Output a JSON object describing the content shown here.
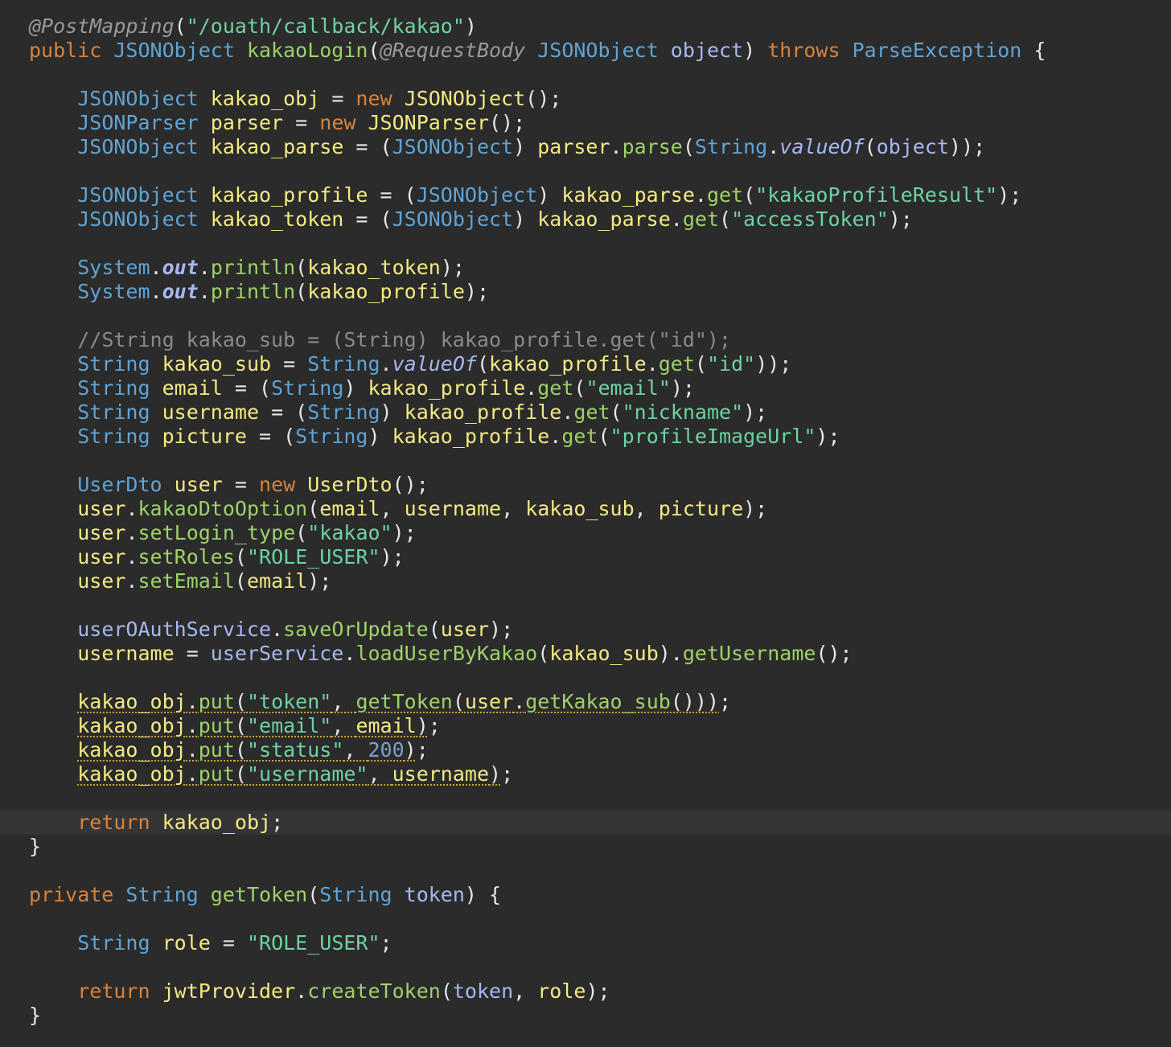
{
  "editor": {
    "theme": "dark",
    "background": "#2b2b2b",
    "current_line_index": 33,
    "colors": {
      "keyword": "#d9823b",
      "type": "#5fa4d6",
      "function": "#9ed267",
      "variable": "#f3ea83",
      "parameter": "#a7b8f3",
      "string": "#6fd2a3",
      "number": "#7d9fd0",
      "annotation": "#9a9a9a",
      "comment": "#8a8a8a",
      "warning_underline": "#c9a33b"
    },
    "lines": [
      [
        [
          "@PostMapping",
          "ann"
        ],
        [
          "(",
          "punc"
        ],
        [
          "\"/ouath/callback/kakao\"",
          "str"
        ],
        [
          ")",
          "punc"
        ]
      ],
      [
        [
          "public",
          "kw"
        ],
        [
          " ",
          "def"
        ],
        [
          "JSONObject",
          "type"
        ],
        [
          " ",
          "def"
        ],
        [
          "kakaoLogin",
          "fn"
        ],
        [
          "(",
          "punc"
        ],
        [
          "@RequestBody",
          "ann"
        ],
        [
          " ",
          "def"
        ],
        [
          "JSONObject",
          "type"
        ],
        [
          " ",
          "def"
        ],
        [
          "object",
          "param"
        ],
        [
          ") ",
          "punc"
        ],
        [
          "throws",
          "kw"
        ],
        [
          " ",
          "def"
        ],
        [
          "ParseException",
          "type"
        ],
        [
          " {",
          "punc"
        ]
      ],
      [],
      [
        [
          "    ",
          "def"
        ],
        [
          "JSONObject",
          "type"
        ],
        [
          " ",
          "def"
        ],
        [
          "kakao_obj",
          "var"
        ],
        [
          " = ",
          "punc"
        ],
        [
          "new",
          "kw"
        ],
        [
          " ",
          "def"
        ],
        [
          "JSONObject",
          "var"
        ],
        [
          "();",
          "punc"
        ]
      ],
      [
        [
          "    ",
          "def"
        ],
        [
          "JSONParser",
          "type"
        ],
        [
          " ",
          "def"
        ],
        [
          "parser",
          "var"
        ],
        [
          " = ",
          "punc"
        ],
        [
          "new",
          "kw"
        ],
        [
          " ",
          "def"
        ],
        [
          "JSONParser",
          "var"
        ],
        [
          "();",
          "punc"
        ]
      ],
      [
        [
          "    ",
          "def"
        ],
        [
          "JSONObject",
          "type"
        ],
        [
          " ",
          "def"
        ],
        [
          "kakao_parse",
          "var"
        ],
        [
          " = (",
          "punc"
        ],
        [
          "JSONObject",
          "type"
        ],
        [
          ") ",
          "punc"
        ],
        [
          "parser",
          "var"
        ],
        [
          ".",
          "punc"
        ],
        [
          "parse",
          "fn"
        ],
        [
          "(",
          "punc"
        ],
        [
          "String",
          "type"
        ],
        [
          ".",
          "punc"
        ],
        [
          "valueOf",
          "static"
        ],
        [
          "(",
          "punc"
        ],
        [
          "object",
          "param"
        ],
        [
          "));",
          "punc"
        ]
      ],
      [],
      [
        [
          "    ",
          "def"
        ],
        [
          "JSONObject",
          "type"
        ],
        [
          " ",
          "def"
        ],
        [
          "kakao_profile",
          "var"
        ],
        [
          " = (",
          "punc"
        ],
        [
          "JSONObject",
          "type"
        ],
        [
          ") ",
          "punc"
        ],
        [
          "kakao_parse",
          "var"
        ],
        [
          ".",
          "punc"
        ],
        [
          "get",
          "fn"
        ],
        [
          "(",
          "punc"
        ],
        [
          "\"kakaoProfileResult\"",
          "str"
        ],
        [
          ");",
          "punc"
        ]
      ],
      [
        [
          "    ",
          "def"
        ],
        [
          "JSONObject",
          "type"
        ],
        [
          " ",
          "def"
        ],
        [
          "kakao_token",
          "var"
        ],
        [
          " = (",
          "punc"
        ],
        [
          "JSONObject",
          "type"
        ],
        [
          ") ",
          "punc"
        ],
        [
          "kakao_parse",
          "var"
        ],
        [
          ".",
          "punc"
        ],
        [
          "get",
          "fn"
        ],
        [
          "(",
          "punc"
        ],
        [
          "\"accessToken\"",
          "str"
        ],
        [
          ");",
          "punc"
        ]
      ],
      [],
      [
        [
          "    ",
          "def"
        ],
        [
          "System",
          "type"
        ],
        [
          ".",
          "punc"
        ],
        [
          "out",
          "field"
        ],
        [
          ".",
          "punc"
        ],
        [
          "println",
          "fn"
        ],
        [
          "(",
          "punc"
        ],
        [
          "kakao_token",
          "var"
        ],
        [
          ");",
          "punc"
        ]
      ],
      [
        [
          "    ",
          "def"
        ],
        [
          "System",
          "type"
        ],
        [
          ".",
          "punc"
        ],
        [
          "out",
          "field"
        ],
        [
          ".",
          "punc"
        ],
        [
          "println",
          "fn"
        ],
        [
          "(",
          "punc"
        ],
        [
          "kakao_profile",
          "var"
        ],
        [
          ");",
          "punc"
        ]
      ],
      [],
      [
        [
          "    ",
          "def"
        ],
        [
          "//String kakao_sub = (String) kakao_profile.get(\"id\");",
          "cmt"
        ]
      ],
      [
        [
          "    ",
          "def"
        ],
        [
          "String",
          "type"
        ],
        [
          " ",
          "def"
        ],
        [
          "kakao_sub",
          "var"
        ],
        [
          " = ",
          "punc"
        ],
        [
          "String",
          "type"
        ],
        [
          ".",
          "punc"
        ],
        [
          "valueOf",
          "static"
        ],
        [
          "(",
          "punc"
        ],
        [
          "kakao_profile",
          "var"
        ],
        [
          ".",
          "punc"
        ],
        [
          "get",
          "fn"
        ],
        [
          "(",
          "punc"
        ],
        [
          "\"id\"",
          "str"
        ],
        [
          "));",
          "punc"
        ]
      ],
      [
        [
          "    ",
          "def"
        ],
        [
          "String",
          "type"
        ],
        [
          " ",
          "def"
        ],
        [
          "email",
          "var"
        ],
        [
          " = (",
          "punc"
        ],
        [
          "String",
          "type"
        ],
        [
          ") ",
          "punc"
        ],
        [
          "kakao_profile",
          "var"
        ],
        [
          ".",
          "punc"
        ],
        [
          "get",
          "fn"
        ],
        [
          "(",
          "punc"
        ],
        [
          "\"email\"",
          "str"
        ],
        [
          ");",
          "punc"
        ]
      ],
      [
        [
          "    ",
          "def"
        ],
        [
          "String",
          "type"
        ],
        [
          " ",
          "def"
        ],
        [
          "username",
          "var"
        ],
        [
          " = (",
          "punc"
        ],
        [
          "String",
          "type"
        ],
        [
          ") ",
          "punc"
        ],
        [
          "kakao_profile",
          "var"
        ],
        [
          ".",
          "punc"
        ],
        [
          "get",
          "fn"
        ],
        [
          "(",
          "punc"
        ],
        [
          "\"nickname\"",
          "str"
        ],
        [
          ");",
          "punc"
        ]
      ],
      [
        [
          "    ",
          "def"
        ],
        [
          "String",
          "type"
        ],
        [
          " ",
          "def"
        ],
        [
          "picture",
          "var"
        ],
        [
          " = (",
          "punc"
        ],
        [
          "String",
          "type"
        ],
        [
          ") ",
          "punc"
        ],
        [
          "kakao_profile",
          "var"
        ],
        [
          ".",
          "punc"
        ],
        [
          "get",
          "fn"
        ],
        [
          "(",
          "punc"
        ],
        [
          "\"profileImageUrl\"",
          "str"
        ],
        [
          ");",
          "punc"
        ]
      ],
      [],
      [
        [
          "    ",
          "def"
        ],
        [
          "UserDto",
          "type"
        ],
        [
          " ",
          "def"
        ],
        [
          "user",
          "var"
        ],
        [
          " = ",
          "punc"
        ],
        [
          "new",
          "kw"
        ],
        [
          " ",
          "def"
        ],
        [
          "UserDto",
          "var"
        ],
        [
          "();",
          "punc"
        ]
      ],
      [
        [
          "    ",
          "def"
        ],
        [
          "user",
          "var"
        ],
        [
          ".",
          "punc"
        ],
        [
          "kakaoDtoOption",
          "fn"
        ],
        [
          "(",
          "punc"
        ],
        [
          "email",
          "var"
        ],
        [
          ", ",
          "punc"
        ],
        [
          "username",
          "var"
        ],
        [
          ", ",
          "punc"
        ],
        [
          "kakao_sub",
          "var"
        ],
        [
          ", ",
          "punc"
        ],
        [
          "picture",
          "var"
        ],
        [
          ");",
          "punc"
        ]
      ],
      [
        [
          "    ",
          "def"
        ],
        [
          "user",
          "var"
        ],
        [
          ".",
          "punc"
        ],
        [
          "setLogin_type",
          "fn"
        ],
        [
          "(",
          "punc"
        ],
        [
          "\"kakao\"",
          "str"
        ],
        [
          ");",
          "punc"
        ]
      ],
      [
        [
          "    ",
          "def"
        ],
        [
          "user",
          "var"
        ],
        [
          ".",
          "punc"
        ],
        [
          "setRoles",
          "fn"
        ],
        [
          "(",
          "punc"
        ],
        [
          "\"ROLE_USER\"",
          "str"
        ],
        [
          ");",
          "punc"
        ]
      ],
      [
        [
          "    ",
          "def"
        ],
        [
          "user",
          "var"
        ],
        [
          ".",
          "punc"
        ],
        [
          "setEmail",
          "fn"
        ],
        [
          "(",
          "punc"
        ],
        [
          "email",
          "var"
        ],
        [
          ");",
          "punc"
        ]
      ],
      [],
      [
        [
          "    ",
          "def"
        ],
        [
          "userOAuthService",
          "param"
        ],
        [
          ".",
          "punc"
        ],
        [
          "saveOrUpdate",
          "fn"
        ],
        [
          "(",
          "punc"
        ],
        [
          "user",
          "var"
        ],
        [
          ");",
          "punc"
        ]
      ],
      [
        [
          "    ",
          "def"
        ],
        [
          "username",
          "var"
        ],
        [
          " = ",
          "punc"
        ],
        [
          "userService",
          "param"
        ],
        [
          ".",
          "punc"
        ],
        [
          "loadUserByKakao",
          "fn"
        ],
        [
          "(",
          "punc"
        ],
        [
          "kakao_sub",
          "var"
        ],
        [
          ").",
          "punc"
        ],
        [
          "getUsername",
          "fn"
        ],
        [
          "();",
          "punc"
        ]
      ],
      [],
      [
        [
          "    ",
          "def"
        ],
        [
          "kakao_obj",
          "var",
          1
        ],
        [
          ".",
          "punc",
          1
        ],
        [
          "put",
          "fn",
          1
        ],
        [
          "(",
          "punc",
          1
        ],
        [
          "\"token\"",
          "str",
          1
        ],
        [
          ", ",
          "punc",
          1
        ],
        [
          "getToken",
          "fn",
          1
        ],
        [
          "(",
          "punc",
          1
        ],
        [
          "user",
          "var",
          1
        ],
        [
          ".",
          "punc",
          1
        ],
        [
          "getKakao_sub",
          "fn",
          1
        ],
        [
          "()))",
          "punc",
          1
        ],
        [
          ";",
          "punc"
        ]
      ],
      [
        [
          "    ",
          "def"
        ],
        [
          "kakao_obj",
          "var",
          1
        ],
        [
          ".",
          "punc",
          1
        ],
        [
          "put",
          "fn",
          1
        ],
        [
          "(",
          "punc",
          1
        ],
        [
          "\"email\"",
          "str",
          1
        ],
        [
          ", ",
          "punc",
          1
        ],
        [
          "email",
          "var",
          1
        ],
        [
          ")",
          "punc",
          1
        ],
        [
          ";",
          "punc"
        ]
      ],
      [
        [
          "    ",
          "def"
        ],
        [
          "kakao_obj",
          "var",
          1
        ],
        [
          ".",
          "punc",
          1
        ],
        [
          "put",
          "fn",
          1
        ],
        [
          "(",
          "punc",
          1
        ],
        [
          "\"status\"",
          "str",
          1
        ],
        [
          ", ",
          "punc",
          1
        ],
        [
          "200",
          "num",
          1
        ],
        [
          ")",
          "punc",
          1
        ],
        [
          ";",
          "punc"
        ]
      ],
      [
        [
          "    ",
          "def"
        ],
        [
          "kakao_obj",
          "var",
          1
        ],
        [
          ".",
          "punc",
          1
        ],
        [
          "put",
          "fn",
          1
        ],
        [
          "(",
          "punc",
          1
        ],
        [
          "\"username\"",
          "str",
          1
        ],
        [
          ", ",
          "punc",
          1
        ],
        [
          "username",
          "var",
          1
        ],
        [
          ")",
          "punc",
          1
        ],
        [
          ";",
          "punc"
        ]
      ],
      [],
      [
        [
          "    ",
          "def"
        ],
        [
          "return",
          "kw"
        ],
        [
          " ",
          "def"
        ],
        [
          "kakao_obj",
          "var"
        ],
        [
          ";",
          "punc"
        ]
      ],
      [
        [
          "}",
          "punc"
        ]
      ],
      [],
      [
        [
          "private",
          "kw"
        ],
        [
          " ",
          "def"
        ],
        [
          "String",
          "type"
        ],
        [
          " ",
          "def"
        ],
        [
          "getToken",
          "fn"
        ],
        [
          "(",
          "punc"
        ],
        [
          "String",
          "type"
        ],
        [
          " ",
          "def"
        ],
        [
          "token",
          "param"
        ],
        [
          ") {",
          "punc"
        ]
      ],
      [],
      [
        [
          "    ",
          "def"
        ],
        [
          "String",
          "type"
        ],
        [
          " ",
          "def"
        ],
        [
          "role",
          "var"
        ],
        [
          " = ",
          "punc"
        ],
        [
          "\"ROLE_USER\"",
          "str"
        ],
        [
          ";",
          "punc"
        ]
      ],
      [],
      [
        [
          "    ",
          "def"
        ],
        [
          "return",
          "kw"
        ],
        [
          " ",
          "def"
        ],
        [
          "jwtProvider",
          "var"
        ],
        [
          ".",
          "punc"
        ],
        [
          "createToken",
          "fn"
        ],
        [
          "(",
          "punc"
        ],
        [
          "token",
          "param"
        ],
        [
          ", ",
          "punc"
        ],
        [
          "role",
          "var"
        ],
        [
          ");",
          "punc"
        ]
      ],
      [
        [
          "}",
          "punc"
        ]
      ]
    ]
  }
}
